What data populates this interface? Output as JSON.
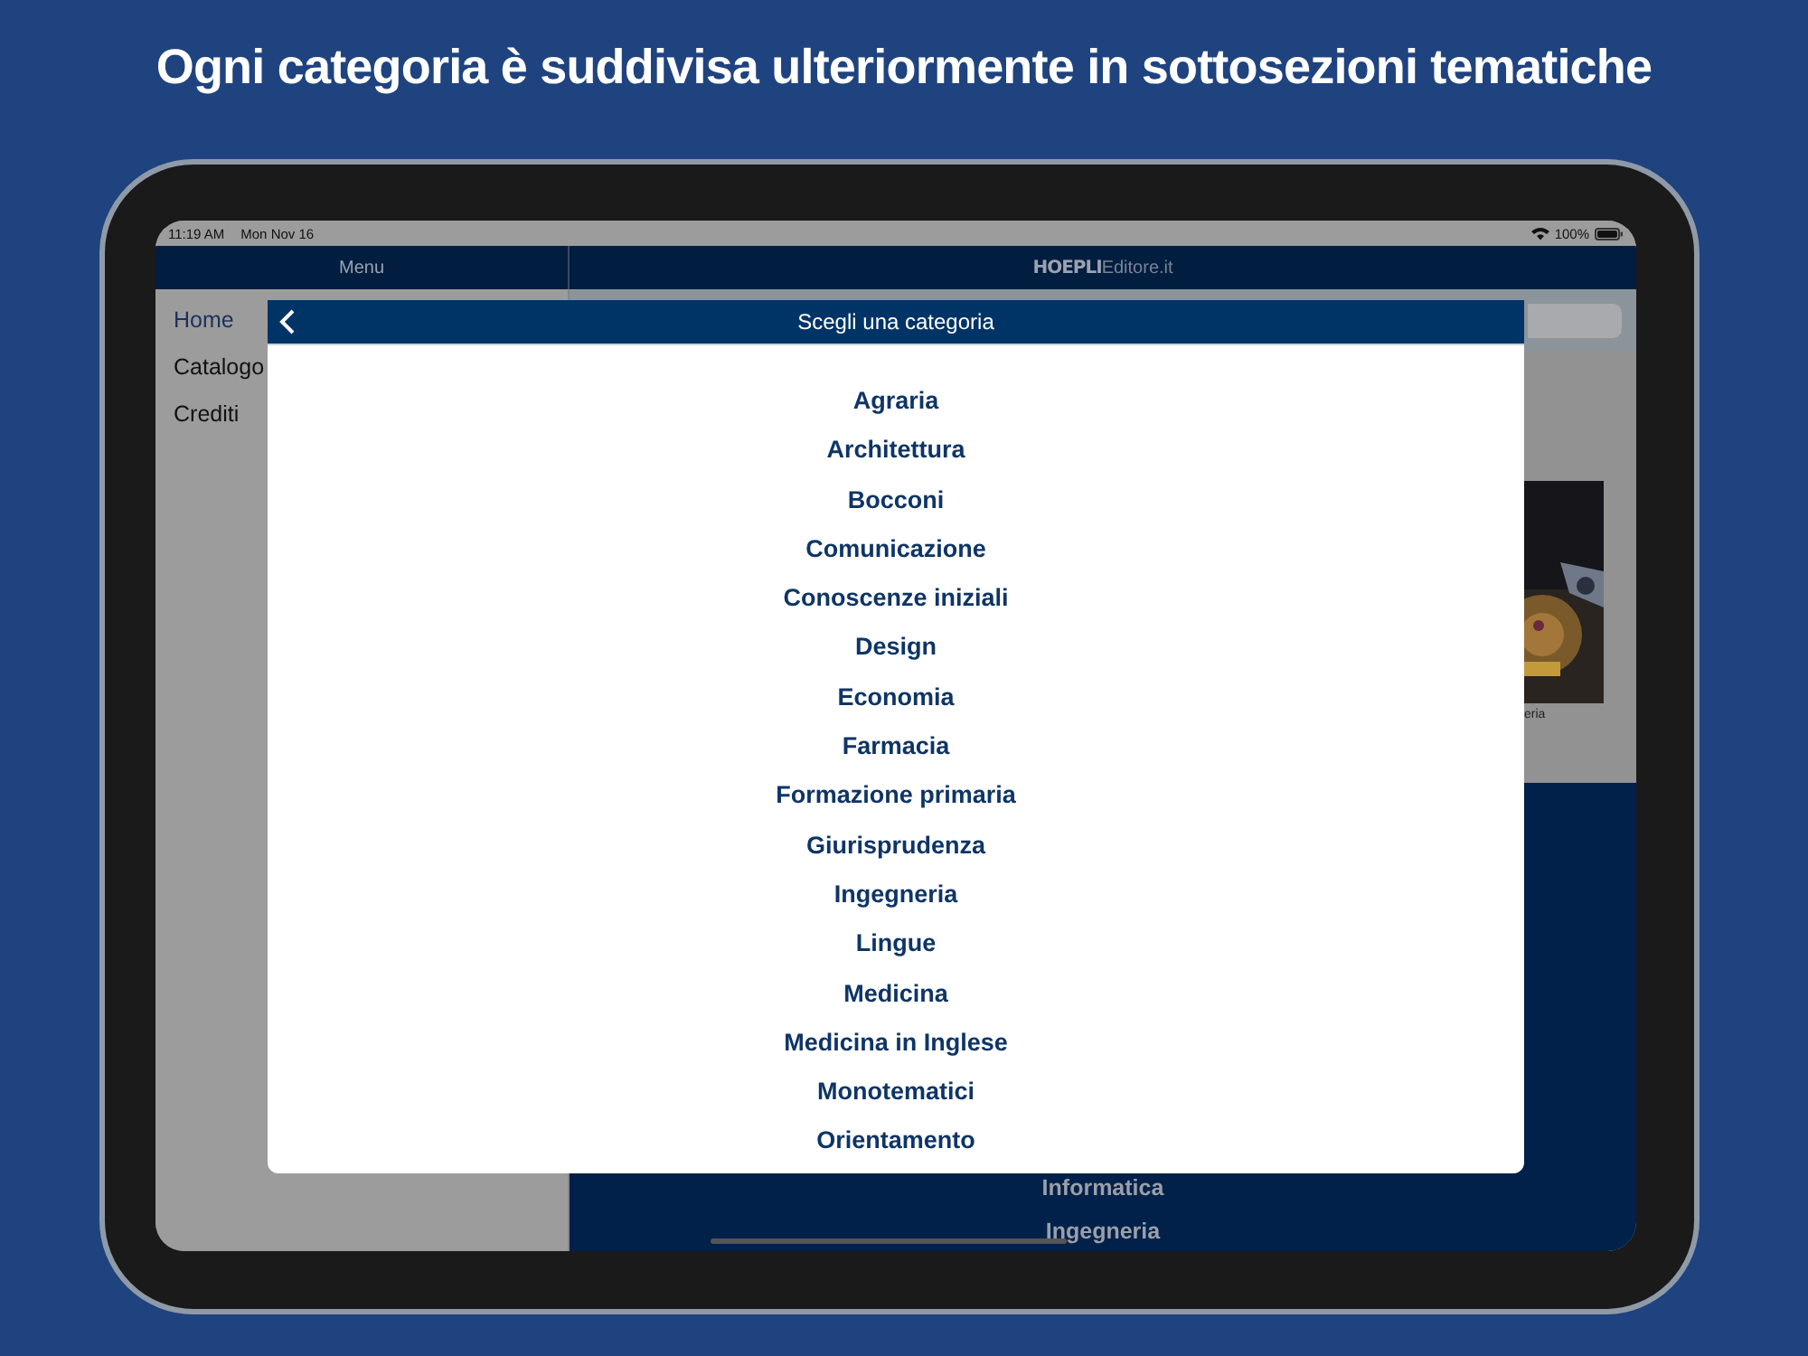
{
  "headline": "Ogni categoria è suddivisa ulteriormente in sottosezioni tematiche",
  "status_bar": {
    "time": "11:19 AM",
    "date": "Mon Nov 16",
    "battery": "100%"
  },
  "nav_bar": {
    "menu_title": "Menu",
    "logo": "**HOEPLI**Editore.it"
  },
  "sidebar": {
    "items": [
      {
        "label": "Home",
        "selected": true
      },
      {
        "label": "Catalogo",
        "selected": false
      },
      {
        "label": "Crediti",
        "selected": false
      }
    ]
  },
  "background_content": {
    "book_caption": "eria",
    "list": [
      "Informatica",
      "Ingegneria"
    ]
  },
  "modal": {
    "title": "Scegli una categoria",
    "categories": [
      "Agraria",
      "Architettura",
      "Bocconi",
      "Comunicazione",
      "Conoscenze iniziali",
      "Design",
      "Economia",
      "Farmacia",
      "Formazione primaria",
      "Giurisprudenza",
      "Ingegneria",
      "Lingue",
      "Medicina",
      "Medicina in Inglese",
      "Monotematici",
      "Orientamento"
    ]
  }
}
